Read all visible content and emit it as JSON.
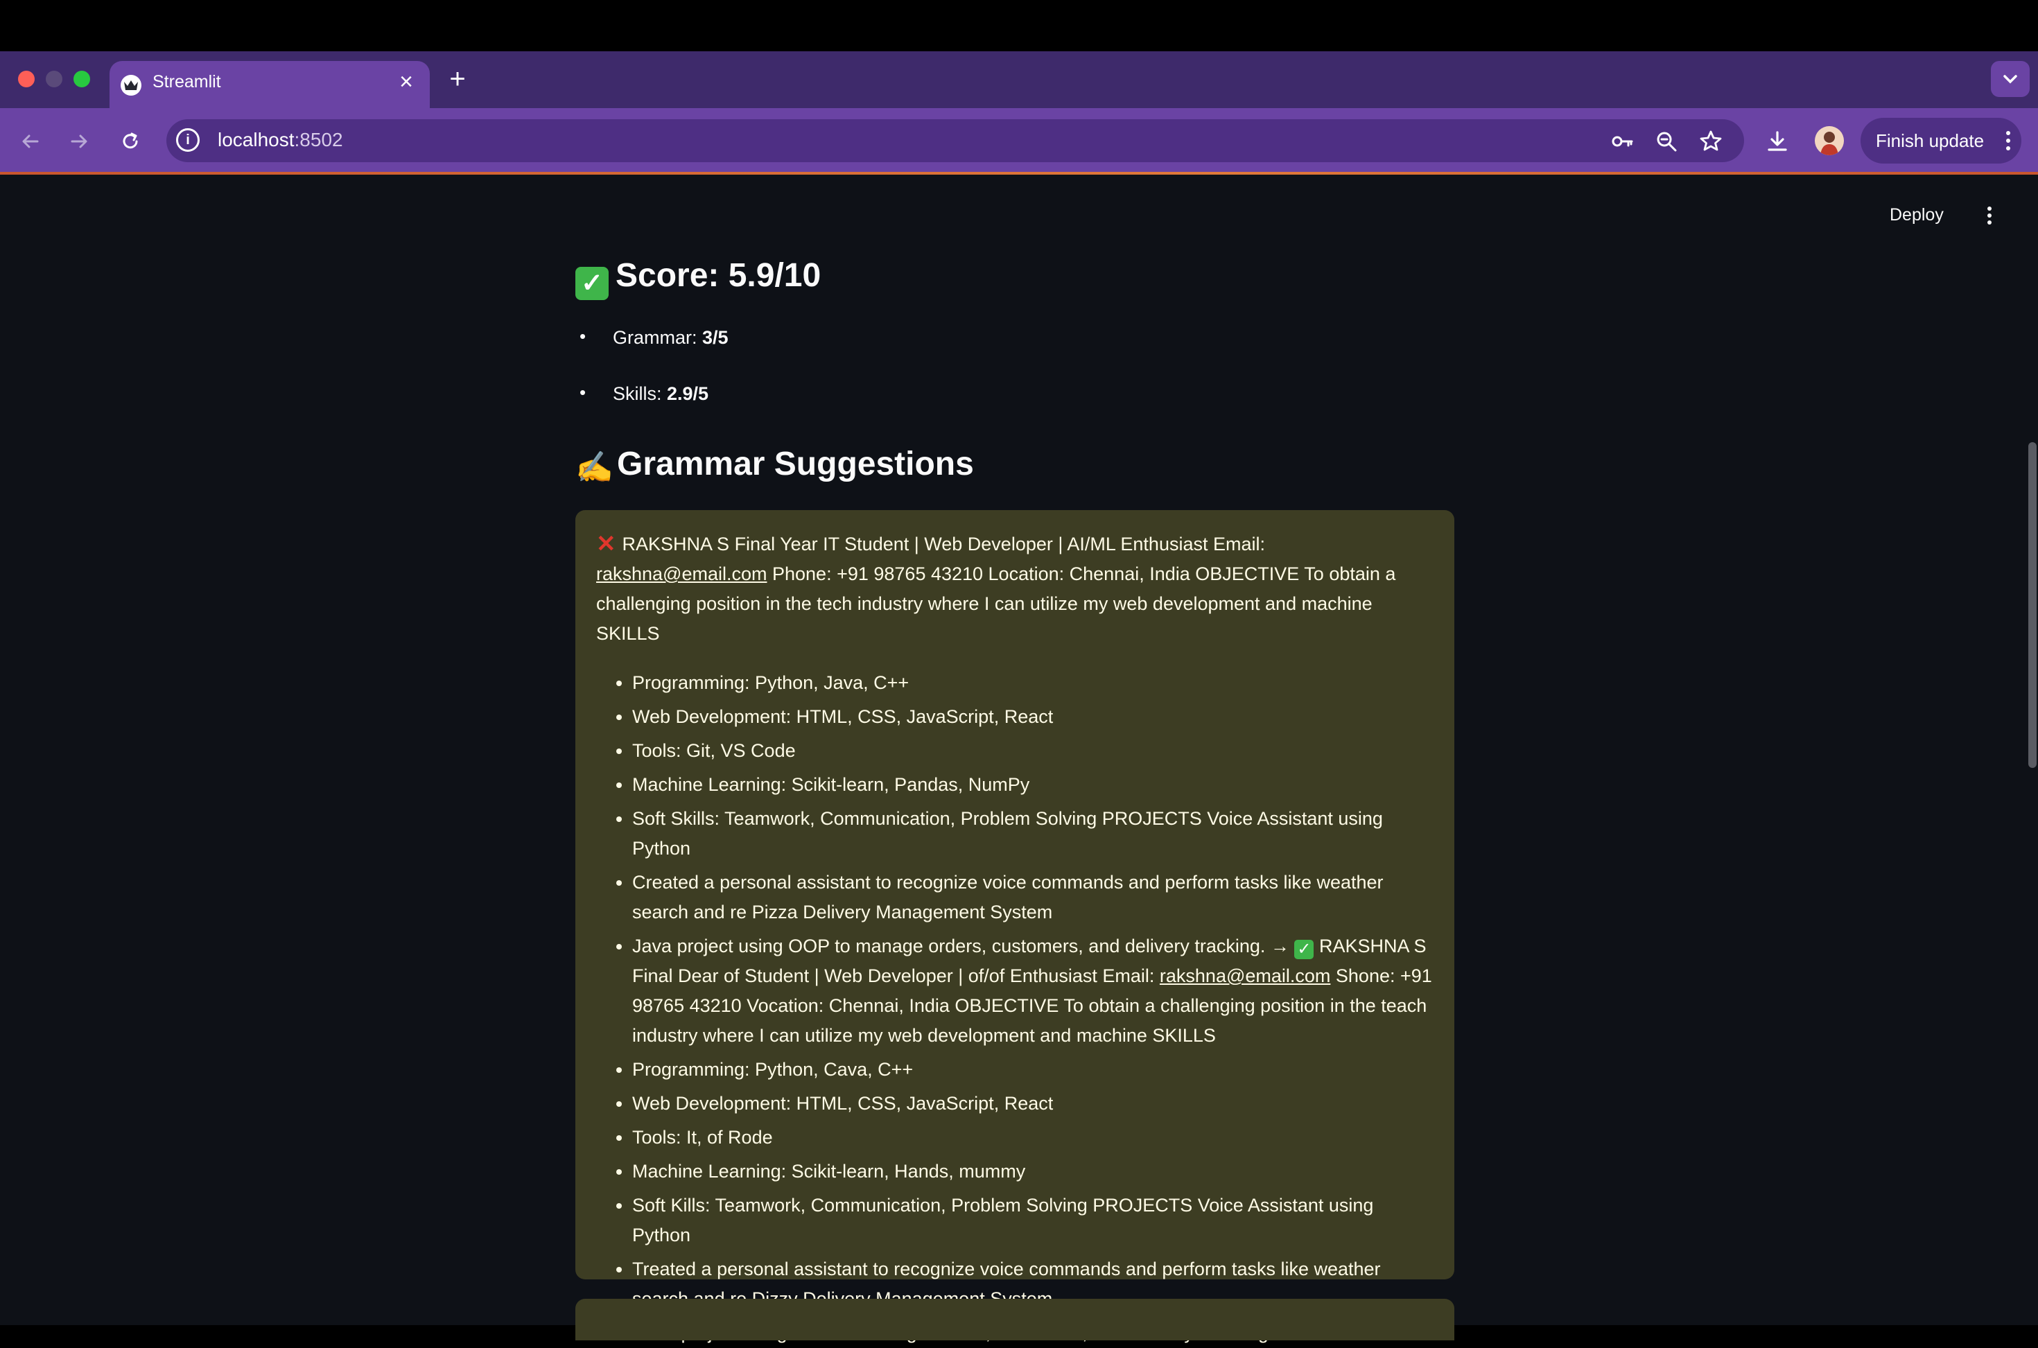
{
  "browser": {
    "tab_title": "Streamlit",
    "url_host": "localhost",
    "url_port": ":8502",
    "finish_update_label": "Finish update",
    "icons": [
      "back-icon",
      "forward-icon",
      "reload-icon",
      "site-info-icon",
      "password-key-icon",
      "zoom-icon",
      "bookmark-star-icon",
      "download-icon",
      "profile-avatar",
      "more-vert-icon"
    ]
  },
  "app": {
    "deploy_label": "Deploy",
    "score_heading": "Score: 5.9/10",
    "metrics": [
      {
        "label": "Grammar: ",
        "value": "3/5"
      },
      {
        "label": "Skills: ",
        "value": "2.9/5"
      }
    ],
    "grammar_heading": "Grammar Suggestions",
    "suggestion": {
      "intro_prefix": "RAKSHNA S Final Year IT Student | Web Developer | AI/ML Enthusiast Email: ",
      "intro_email": "rakshna@email.com",
      "intro_suffix": " Phone: +91 98765 43210 Location: Chennai, India OBJECTIVE To obtain a challenging position in the tech industry where I can utilize my web development and machine SKILLS",
      "items_before": [
        "Programming: Python, Java, C++",
        "Web Development: HTML, CSS, JavaScript, React",
        "Tools: Git, VS Code",
        "Machine Learning: Scikit-learn, Pandas, NumPy",
        "Soft Skills: Teamwork, Communication, Problem Solving PROJECTS Voice Assistant using Python",
        "Created a personal assistant to recognize voice commands and perform tasks like weather search and re Pizza Delivery Management System"
      ],
      "java_item_prefix": "Java project using OOP to manage orders, customers, and delivery tracking. → ",
      "java_item_middle": " RAKSHNA S Final Dear of Student | Web Developer | of/of Enthusiast Email: ",
      "java_item_email": "rakshna@email.com",
      "java_item_suffix": " Shone: +91 98765 43210 Vocation: Chennai, India OBJECTIVE To obtain a challenging position in the teach industry where I can utilize my web development and machine SKILLS",
      "items_after": [
        "Programming: Python, Cava, C++",
        "Web Development: HTML, CSS, JavaScript, React",
        "Tools: It, of Rode",
        "Machine Learning: Scikit-learn, Hands, mummy",
        "Soft Kills: Teamwork, Communication, Problem Solving PROJECTS Voice Assistant using Python",
        "Treated a personal assistant to recognize voice commands and perform tasks like weather search and re Dizzy Delivery Management System",
        "Cava project using OOP to manage orders, customers, and delivery cracking."
      ]
    }
  },
  "colors": {
    "chrome_purple": "#6a43a4",
    "page_bg": "#0e1117",
    "callout_bg": "#3d3d23",
    "check_green": "#3fb54a",
    "error_red": "#e0362c"
  }
}
